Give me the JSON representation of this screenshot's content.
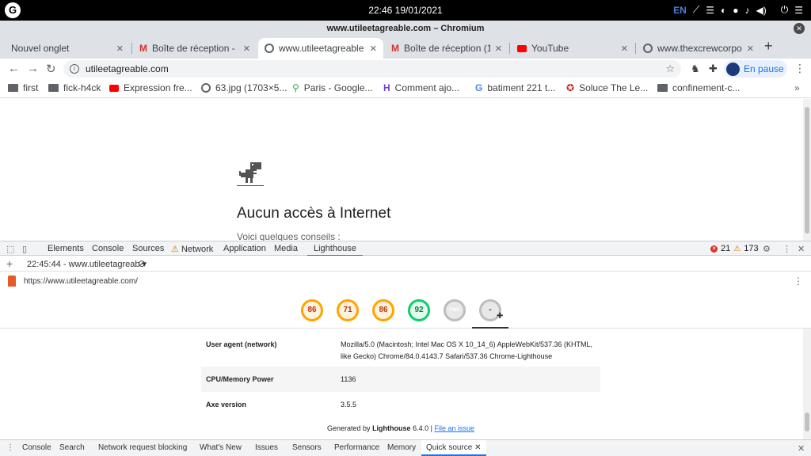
{
  "os": {
    "clock": "22:46 19/01/2021",
    "lang": "EN"
  },
  "window": {
    "title": "www.utileetagreable.com – Chromium"
  },
  "tabs": [
    {
      "label": "Nouvel onglet"
    },
    {
      "label": "Boîte de réception - m"
    },
    {
      "label": "www.utileetagreable"
    },
    {
      "label": "Boîte de réception (1"
    },
    {
      "label": "YouTube"
    },
    {
      "label": "www.thexcrewcorpor"
    }
  ],
  "toolbar": {
    "url": "utileetagreable.com",
    "profile_label": "En pause"
  },
  "bookmarks": [
    {
      "label": "first"
    },
    {
      "label": "fick-h4ck"
    },
    {
      "label": "Expression fre..."
    },
    {
      "label": "63.jpg (1703×5..."
    },
    {
      "label": "Paris - Google..."
    },
    {
      "label": "Comment ajo..."
    },
    {
      "label": "batiment 221 t..."
    },
    {
      "label": "Soluce The Le..."
    },
    {
      "label": "confinement-c..."
    }
  ],
  "page": {
    "title": "Aucun accès à Internet",
    "subtitle": "Voici quelques conseils :"
  },
  "devtools": {
    "tabs": [
      "Elements",
      "Console",
      "Sources",
      "Network",
      "Application",
      "Media",
      "Lighthouse"
    ],
    "errors": "21",
    "warnings": "173",
    "report_select": "22:45:44 - www.utileetagreab ▾",
    "report_url": "https://www.utileetagreable.com/",
    "scores": [
      "86",
      "71",
      "86",
      "92"
    ],
    "pwa_label": "PWA",
    "plugin_label": "-",
    "env_rows": [
      {
        "key": "User agent (network)",
        "value": "Mozilla/5.0 (Macintosh; Intel Mac OS X 10_14_6) AppleWebKit/537.36 (KHTML, like Gecko) Chrome/84.0.4143.7 Safari/537.36 Chrome-Lighthouse"
      },
      {
        "key": "CPU/Memory Power",
        "value": "1136"
      },
      {
        "key": "Axe version",
        "value": "3.5.5"
      }
    ],
    "footer": {
      "generated_by": "Generated by",
      "tool": "Lighthouse",
      "version": "6.4.0 |",
      "link": "File an issue"
    },
    "drawer_tabs": [
      "Console",
      "Search",
      "Network request blocking",
      "What's New",
      "Issues",
      "Sensors",
      "Performance",
      "Memory",
      "Quick source"
    ]
  }
}
